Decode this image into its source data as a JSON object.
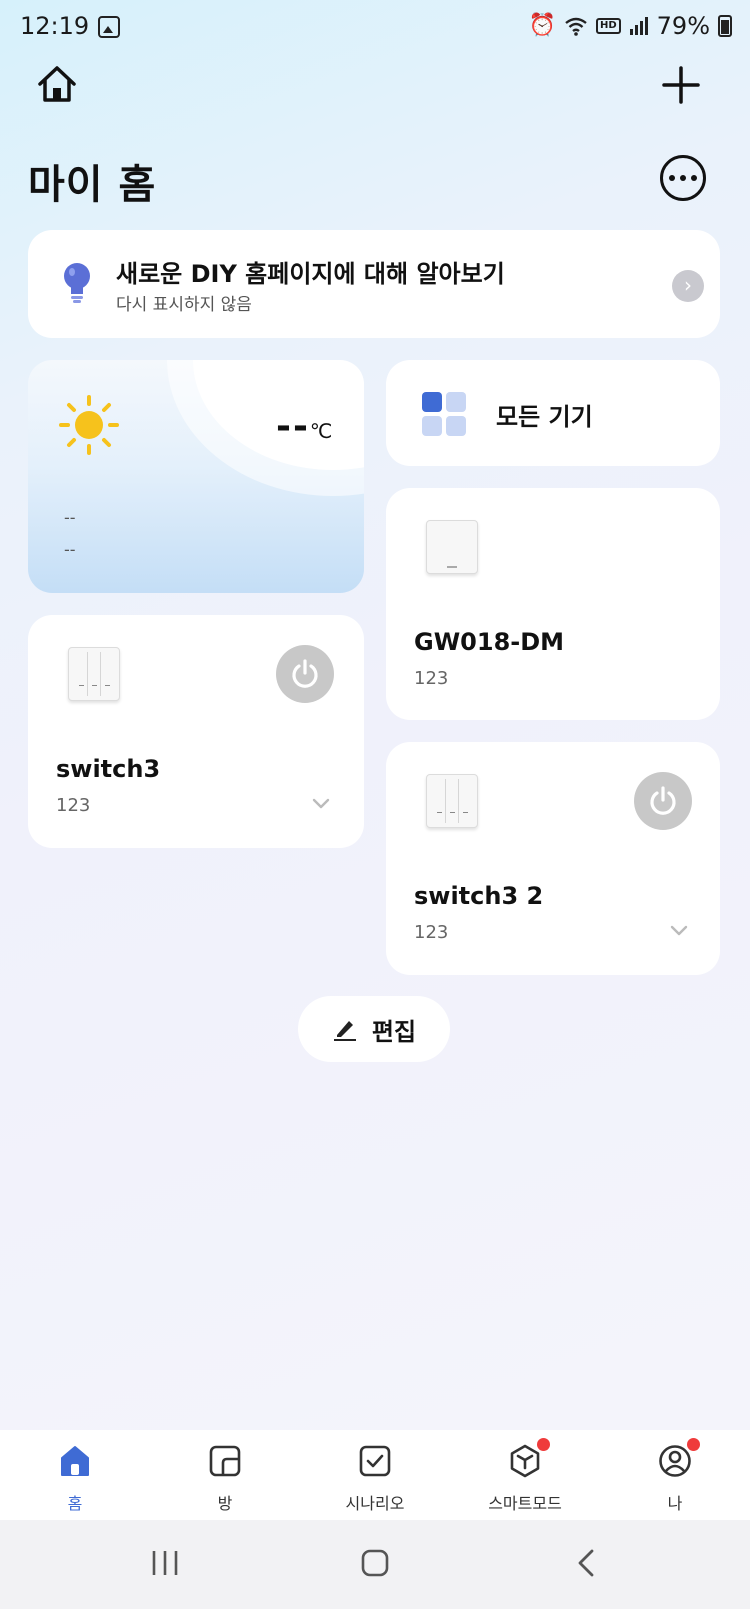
{
  "status_bar": {
    "time": "12:19",
    "battery": "79%",
    "hd_label": "HD"
  },
  "header": {
    "title": "마이 홈"
  },
  "banner": {
    "title": "새로운 DIY 홈페이지에 대해 알아보기",
    "subtitle": "다시 표시하지 않음",
    "chevron": "›"
  },
  "weather": {
    "temperature": "--",
    "unit": "℃",
    "line1": "--",
    "line2": "--"
  },
  "all_devices": {
    "label": "모든 기기"
  },
  "devices": [
    {
      "name": "GW018-DM",
      "room": "123"
    },
    {
      "name": "switch3",
      "room": "123"
    },
    {
      "name": "switch3 2",
      "room": "123"
    }
  ],
  "edit_button": {
    "label": "편집"
  },
  "bottom_nav": [
    {
      "label": "홈",
      "icon": "home-icon",
      "active": true
    },
    {
      "label": "방",
      "icon": "room-icon",
      "active": false
    },
    {
      "label": "시나리오",
      "icon": "scenario-check-icon",
      "active": false
    },
    {
      "label": "스마트모드",
      "icon": "smart-mode-icon",
      "active": false,
      "badge": true
    },
    {
      "label": "나",
      "icon": "profile-icon",
      "active": false,
      "badge": true
    }
  ],
  "colors": {
    "accent": "#3f6bd4",
    "badge": "#ef3b3b",
    "power_off": "#c8c8c8"
  }
}
